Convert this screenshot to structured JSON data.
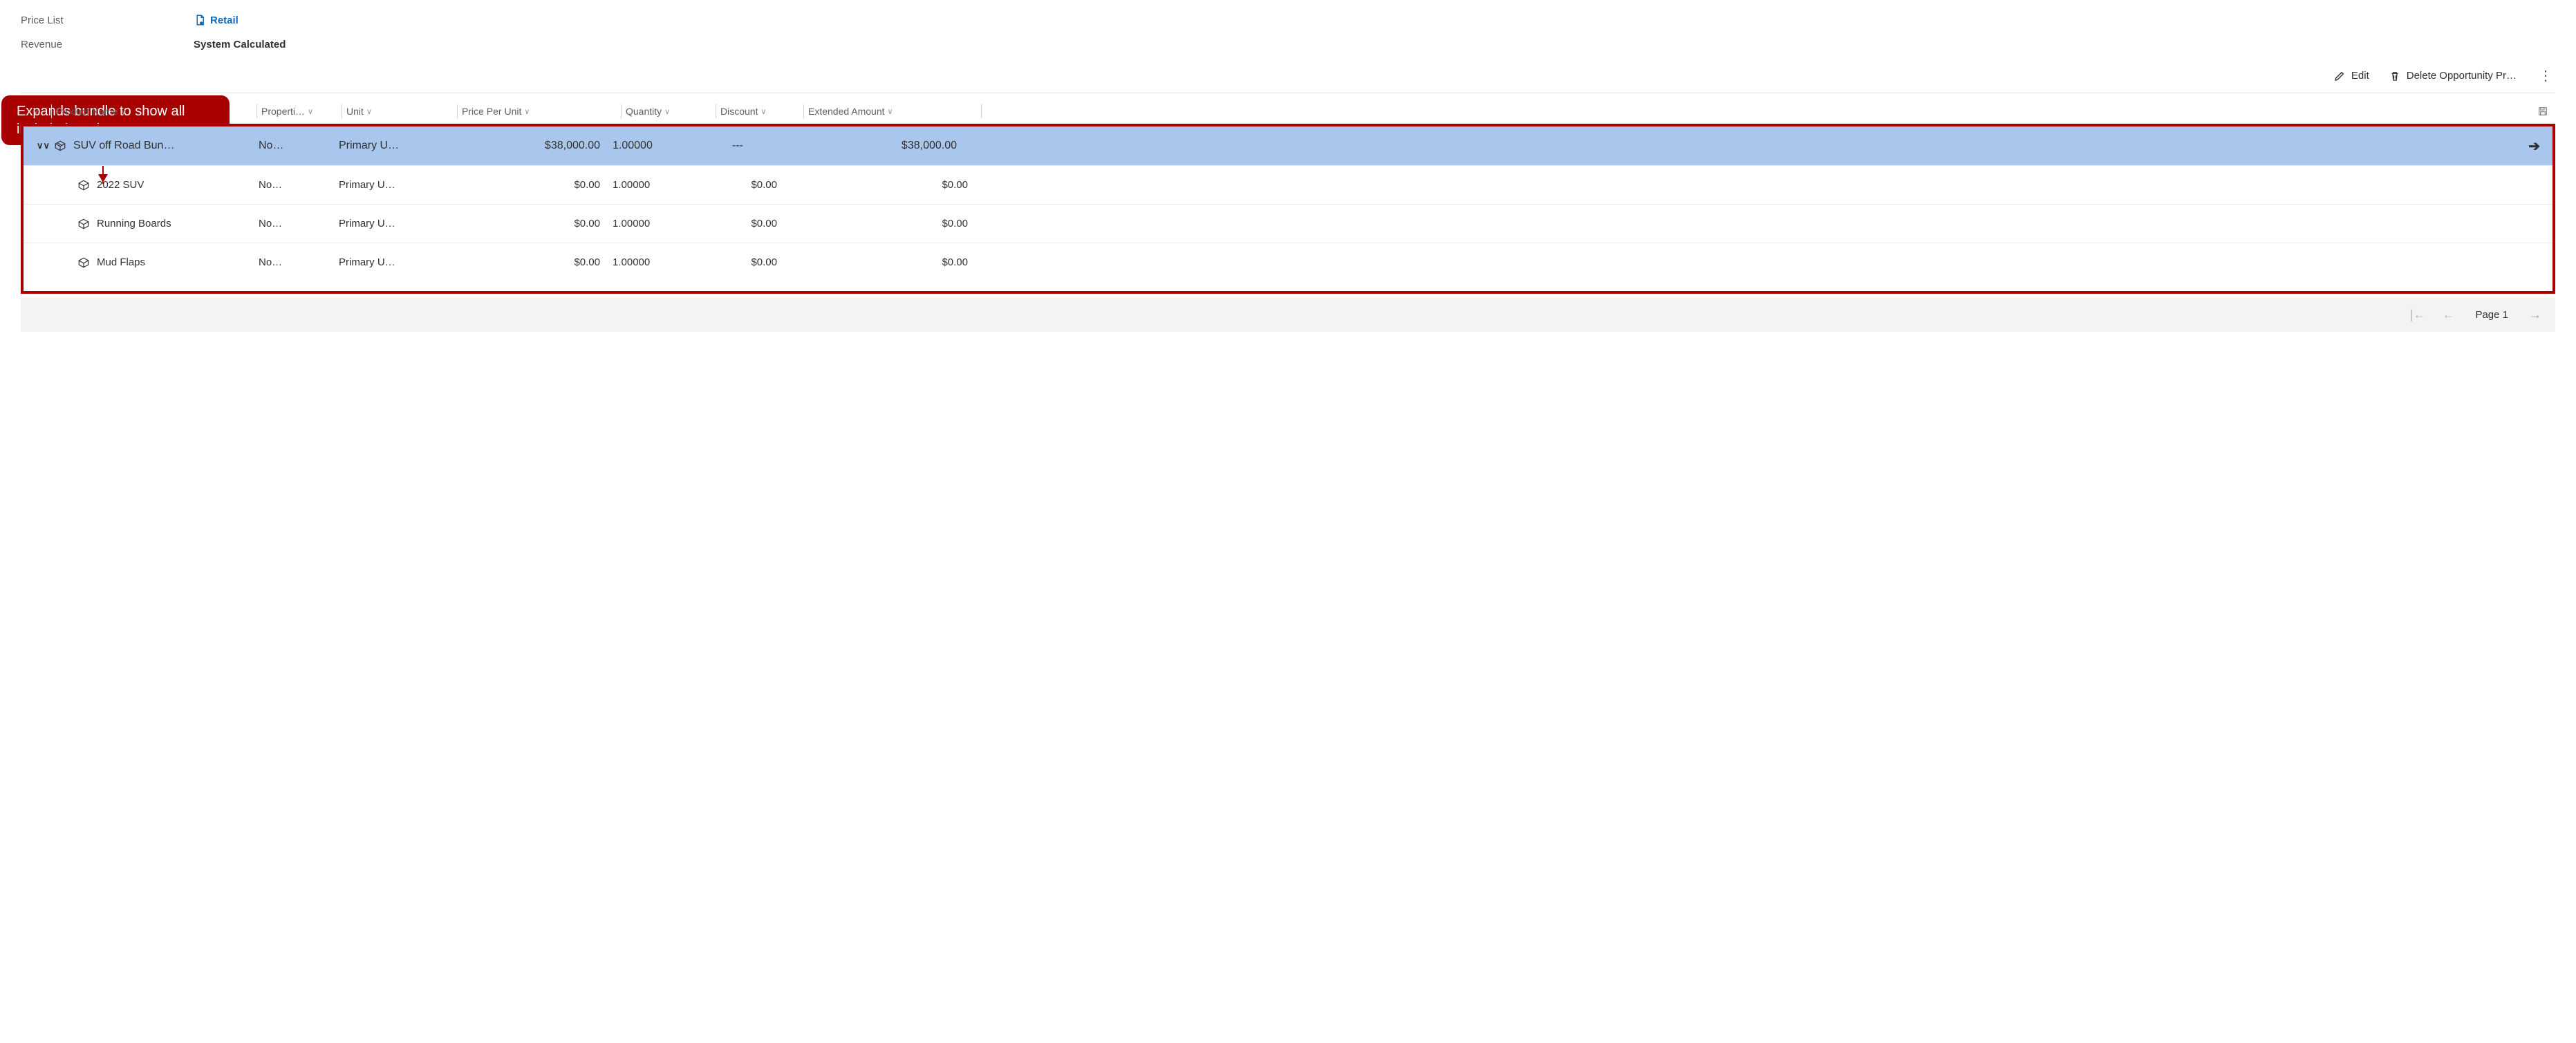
{
  "form": {
    "price_list_label": "Price List",
    "price_list_value": "Retail",
    "revenue_label": "Revenue",
    "revenue_value": "System Calculated"
  },
  "toolbar": {
    "edit": "Edit",
    "delete": "Delete Opportunity Pr…"
  },
  "callout": "Expands bundle to show all included products.",
  "grid": {
    "headers": {
      "name": "Product Name",
      "prop": "Properti…",
      "unit": "Unit",
      "price": "Price Per Unit",
      "qty": "Quantity",
      "disc": "Discount",
      "ext": "Extended Amount"
    },
    "bundle": {
      "name": "SUV off Road Bun…",
      "prop": "No…",
      "unit": "Primary U…",
      "price": "$38,000.00",
      "qty": "1.00000",
      "disc": "---",
      "ext": "$38,000.00"
    },
    "children": [
      {
        "name": "2022 SUV",
        "prop": "No…",
        "unit": "Primary U…",
        "price": "$0.00",
        "qty": "1.00000",
        "disc": "$0.00",
        "ext": "$0.00"
      },
      {
        "name": "Running Boards",
        "prop": "No…",
        "unit": "Primary U…",
        "price": "$0.00",
        "qty": "1.00000",
        "disc": "$0.00",
        "ext": "$0.00"
      },
      {
        "name": "Mud Flaps",
        "prop": "No…",
        "unit": "Primary U…",
        "price": "$0.00",
        "qty": "1.00000",
        "disc": "$0.00",
        "ext": "$0.00"
      }
    ]
  },
  "footer": {
    "page": "Page 1"
  }
}
